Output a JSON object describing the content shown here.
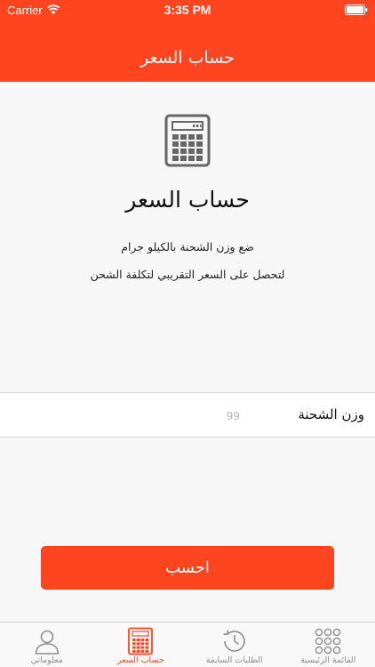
{
  "status_bar": {
    "carrier": "Carrier",
    "time": "3:35 PM"
  },
  "header": {
    "title": "حساب السعر"
  },
  "main": {
    "icon": "calculator-icon",
    "title": "حساب السعر",
    "instruction_line1": "ضع وزن الشحنة بالكيلو جرام",
    "instruction_line2": "لتحصل على السعر التقريبي لتكلفة الشحن"
  },
  "weight_field": {
    "label": "وزن الشحنة",
    "placeholder": "99",
    "value": ""
  },
  "calculate_button": {
    "label": "احسب"
  },
  "tab_bar": {
    "tabs": [
      {
        "label": "معلوماتي",
        "icon": "person-icon",
        "active": false
      },
      {
        "label": "حساب السعر",
        "icon": "calculator-icon",
        "active": true
      },
      {
        "label": "الطلبات السابقة",
        "icon": "history-icon",
        "active": false
      },
      {
        "label": "القائمة الرئيسية",
        "icon": "grid-icon",
        "active": false
      }
    ]
  },
  "colors": {
    "accent": "#ff4420",
    "inactive_tab": "#8e8e8e",
    "icon_gray": "#666666"
  }
}
